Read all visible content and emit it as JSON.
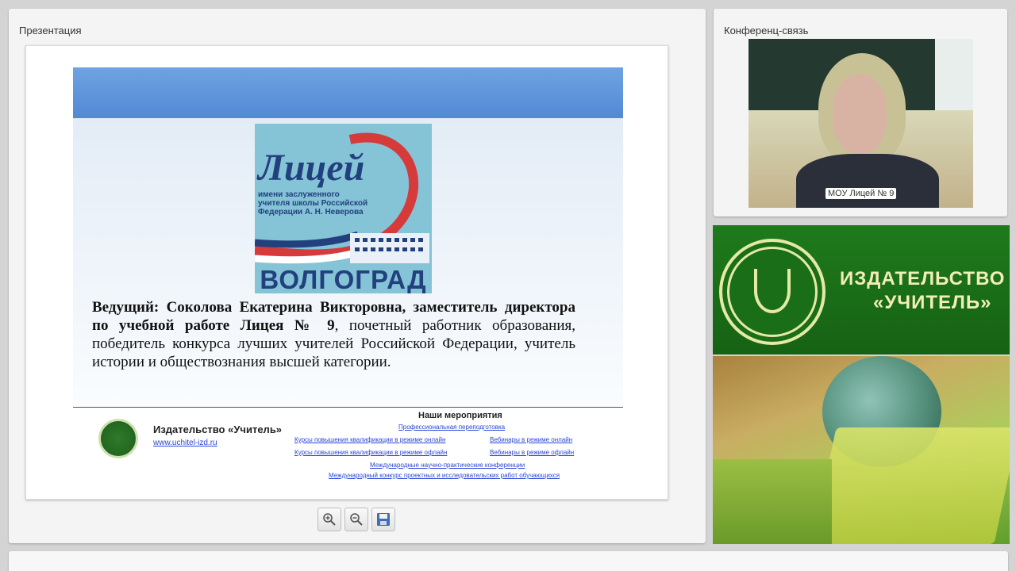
{
  "presentation_panel": {
    "title": "Презентация",
    "slide": {
      "logo_word": "Лицей",
      "logo_subtitle": "имени заслуженного учителя школы Российской Федерации А. Н. Неверова",
      "logo_city": "ВОЛГОГРАД",
      "presenter_bold": "Ведущий: Соколова Екатерина Викторовна, заместитель директора по учебной работе Лицея № 9",
      "presenter_rest": ", почетный работник образования, победитель конкурса лучших учителей Российской Федерации, учитель истории и обществознания высшей категории.",
      "footer_publisher": "Издательство «Учитель»",
      "footer_url": "www.uchitel-izd.ru",
      "events_title": "Наши мероприятия",
      "events": [
        "Профессиональная переподготовка",
        "Курсы повышения квалификации в режиме онлайн",
        "Вебинары в режиме онлайн",
        "Курсы повышения квалификации в режиме офлайн",
        "Вебинары в режиме офлайн",
        "Международные научно-практические конференции",
        "Международный конкурс проектных и исследовательских работ обучающихся"
      ]
    },
    "toolbar": {
      "zoom_in_icon": "zoom-in-icon",
      "zoom_out_icon": "zoom-out-icon",
      "save_icon": "save-icon"
    }
  },
  "conference_panel": {
    "title": "Конференц-связь",
    "participant_label": "МОУ Лицей № 9"
  },
  "banner": {
    "line1": "ИЗДАТЕЛЬСТВО",
    "line2": "«УЧИТЕЛЬ»"
  },
  "colors": {
    "banner_green": "#1f7a1c",
    "link_blue": "#2b45d6",
    "slide_header_blue": "#5f96dc"
  }
}
